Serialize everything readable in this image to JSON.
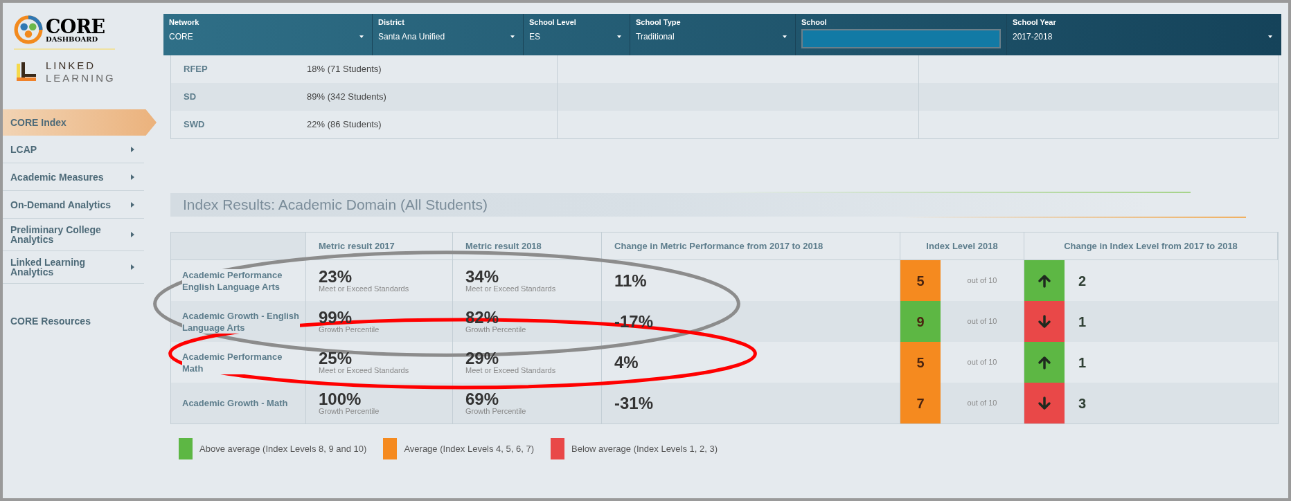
{
  "brand": {
    "logo_title": "CORE",
    "logo_subtitle": "DASHBOARD",
    "partner_line1": "LINKED",
    "partner_line2": "LEARNING"
  },
  "sidebar": {
    "items": [
      {
        "label": "CORE Index",
        "selected": true,
        "submenu": false
      },
      {
        "label": "LCAP",
        "selected": false,
        "submenu": true
      },
      {
        "label": "Academic Measures",
        "selected": false,
        "submenu": true
      },
      {
        "label": "On-Demand Analytics",
        "selected": false,
        "submenu": true
      },
      {
        "label": "Preliminary College Analytics",
        "selected": false,
        "submenu": true
      },
      {
        "label": "Linked Learning Analytics",
        "selected": false,
        "submenu": true
      }
    ],
    "footer_link": "CORE Resources"
  },
  "filters": [
    {
      "label": "Network",
      "kind": "select",
      "value": "CORE"
    },
    {
      "label": "District",
      "kind": "select",
      "value": "Santa Ana Unified"
    },
    {
      "label": "School Level",
      "kind": "select",
      "value": "ES"
    },
    {
      "label": "School Type",
      "kind": "select",
      "value": "Traditional"
    },
    {
      "label": "School",
      "kind": "input",
      "focused": true
    },
    {
      "label": "School Year",
      "kind": "select",
      "value": "2017-2018"
    }
  ],
  "subgroups": [
    {
      "name": "RFEP",
      "value": "18% (71 Students)"
    },
    {
      "name": "SD",
      "value": "89% (342 Students)"
    },
    {
      "name": "SWD",
      "value": "22% (86 Students)"
    }
  ],
  "section_title": "Index Results: Academic Domain (All Students)",
  "results": {
    "columns": [
      "Metric result 2017",
      "Metric result 2018",
      "Change in Metric Performance from 2017 to 2018",
      "Index Level 2018",
      "Change in Index Level from 2017 to 2018"
    ],
    "rows": [
      {
        "metric": "Academic Performance English Language Arts",
        "result_2017": "23%",
        "result_2017_note": "Meet or Exceed Standards",
        "result_2018": "34%",
        "result_2018_note": "Meet or Exceed Standards",
        "change": "11%",
        "index_level": {
          "value": "5",
          "color": "#f58a1f"
        },
        "out_of": "out of 10",
        "index_change": {
          "value": "2",
          "kind": "up",
          "color": "#5db744"
        }
      },
      {
        "metric": "Academic Growth - English Language Arts",
        "result_2017": "99%",
        "result_2017_note": "Growth Percentile",
        "result_2018": "82%",
        "result_2018_note": "Growth Percentile",
        "change": "-17%",
        "index_level": {
          "value": "9",
          "color": "#5db744"
        },
        "out_of": "out of 10",
        "index_change": {
          "value": "1",
          "kind": "down",
          "color": "#e94848"
        }
      },
      {
        "metric": "Academic Performance Math",
        "result_2017": "25%",
        "result_2017_note": "Meet or Exceed Standards",
        "result_2018": "29%",
        "result_2018_note": "Meet or Exceed Standards",
        "change": "4%",
        "index_level": {
          "value": "5",
          "color": "#f58a1f"
        },
        "out_of": "out of 10",
        "index_change": {
          "value": "1",
          "kind": "up",
          "color": "#5db744"
        }
      },
      {
        "metric": "Academic Growth - Math",
        "result_2017": "100%",
        "result_2017_note": "Growth Percentile",
        "result_2018": "69%",
        "result_2018_note": "Growth Percentile",
        "change": "-31%",
        "index_level": {
          "value": "7",
          "color": "#f58a1f"
        },
        "out_of": "out of 10",
        "index_change": {
          "value": "3",
          "kind": "down",
          "color": "#e94848"
        }
      }
    ]
  },
  "legend": [
    {
      "label": "Above average (Index Levels 8, 9 and 10)",
      "color": "#5db744"
    },
    {
      "label": "Average (Index Levels 4, 5, 6, 7)",
      "color": "#f58a1f"
    },
    {
      "label": "Below average (Index Levels 1, 2, 3)",
      "color": "#e94848"
    }
  ],
  "annotations": [
    {
      "kind": "ellipse",
      "color": "#8c8c8c"
    },
    {
      "kind": "ellipse",
      "color": "#ff0000"
    }
  ]
}
